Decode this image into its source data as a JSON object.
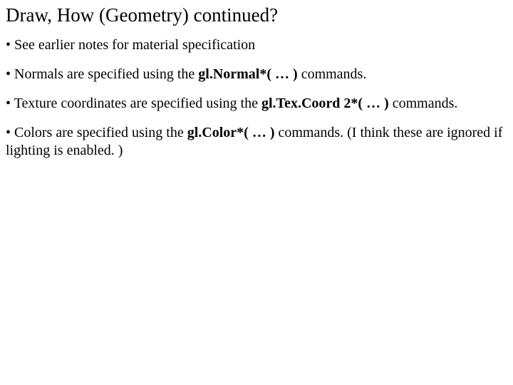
{
  "title": "Draw, How (Geometry) continued?",
  "bullets": {
    "b0": {
      "pre": "• See earlier notes for material specification"
    },
    "b1": {
      "pre": "• Normals are specified using the ",
      "bold": "gl.Normal*( … )",
      "post": " commands."
    },
    "b2": {
      "pre": "• Texture coordinates are specified using the ",
      "bold": "gl.Tex.Coord 2*( … )",
      "post": " commands."
    },
    "b3": {
      "pre": "• Colors are specified using the ",
      "bold": "gl.Color*( … )",
      "post": " commands. (I think these are ignored if lighting is enabled. )"
    }
  }
}
